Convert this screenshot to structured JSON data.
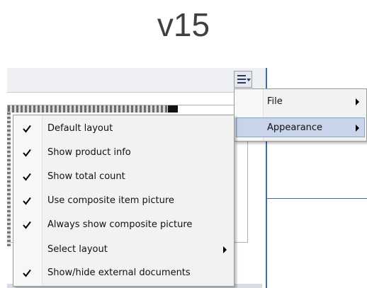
{
  "header": {
    "version_label": "v15"
  },
  "toolbar": {
    "menu_button_icon": "hamburger-menu-icon"
  },
  "main_menu": {
    "items": [
      {
        "label": "File",
        "has_submenu": true,
        "highlighted": false
      },
      {
        "label": "Appearance",
        "has_submenu": true,
        "highlighted": true
      }
    ]
  },
  "appearance_submenu": {
    "items": [
      {
        "label": "Default layout",
        "checked": true,
        "has_submenu": false
      },
      {
        "label": "Show product info",
        "checked": true,
        "has_submenu": false
      },
      {
        "label": "Show total count",
        "checked": true,
        "has_submenu": false
      },
      {
        "label": "Use composite item picture",
        "checked": true,
        "has_submenu": false
      },
      {
        "label": "Always show composite picture",
        "checked": true,
        "has_submenu": false
      },
      {
        "label": "Select layout",
        "checked": false,
        "has_submenu": true
      },
      {
        "label": "Show/hide external documents",
        "checked": true,
        "has_submenu": false
      }
    ]
  },
  "colors": {
    "highlight": "#c7d4ea",
    "accent_line": "#3b6ea8"
  }
}
